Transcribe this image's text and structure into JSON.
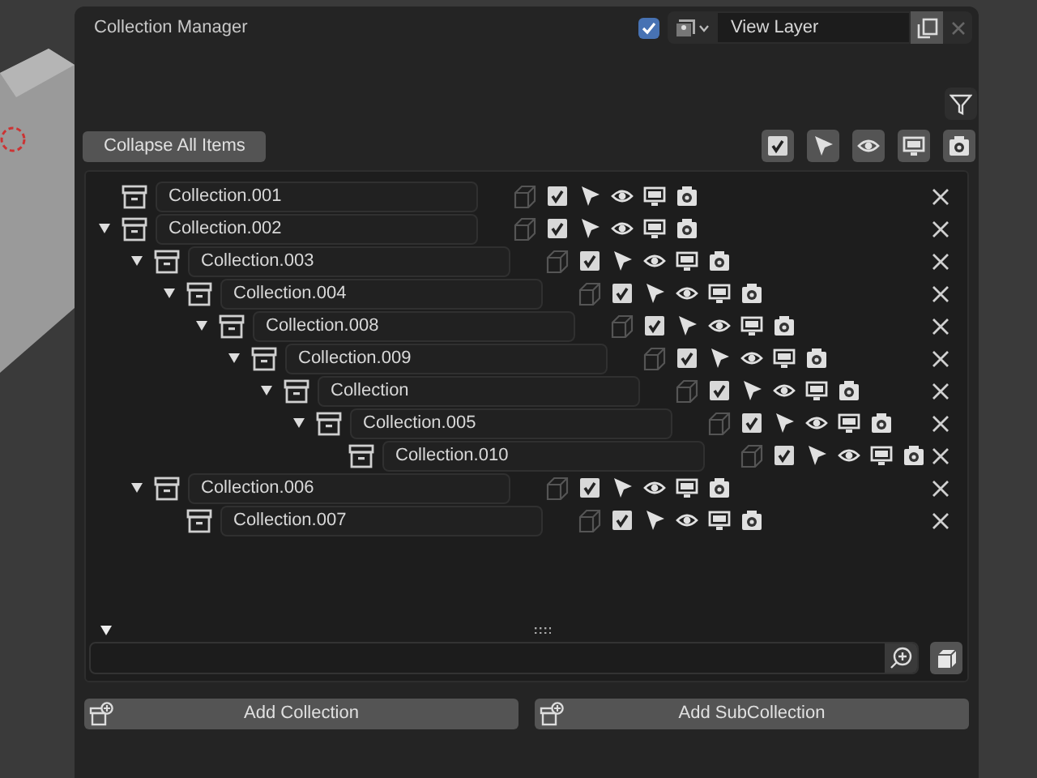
{
  "header": {
    "title": "Collection Manager",
    "checked": true,
    "view_layer": "View Layer"
  },
  "toolbar": {
    "collapse_button": "Collapse All Items"
  },
  "tree": [
    {
      "name": "Collection.001",
      "checked": true
    },
    {
      "name": "Collection.002",
      "checked": true,
      "expanded": true,
      "children": [
        {
          "name": "Collection.003",
          "checked": true,
          "expanded": true,
          "children": [
            {
              "name": "Collection.004",
              "checked": true,
              "expanded": true,
              "children": [
                {
                  "name": "Collection.008",
                  "checked": true,
                  "expanded": true,
                  "children": [
                    {
                      "name": "Collection.009",
                      "checked": true,
                      "expanded": true,
                      "children": [
                        {
                          "name": "Collection",
                          "checked": true,
                          "expanded": true,
                          "children": [
                            {
                              "name": "Collection.005",
                              "checked": true,
                              "expanded": true,
                              "children": [
                                {
                                  "name": "Collection.010",
                                  "checked": true
                                }
                              ]
                            }
                          ]
                        }
                      ]
                    }
                  ]
                }
              ]
            }
          ]
        },
        {
          "name": "Collection.006",
          "checked": true,
          "expanded": true,
          "children": [
            {
              "name": "Collection.007",
              "checked": true
            }
          ]
        }
      ]
    }
  ],
  "buttons": [
    "Add Collection",
    "Add SubCollection"
  ]
}
